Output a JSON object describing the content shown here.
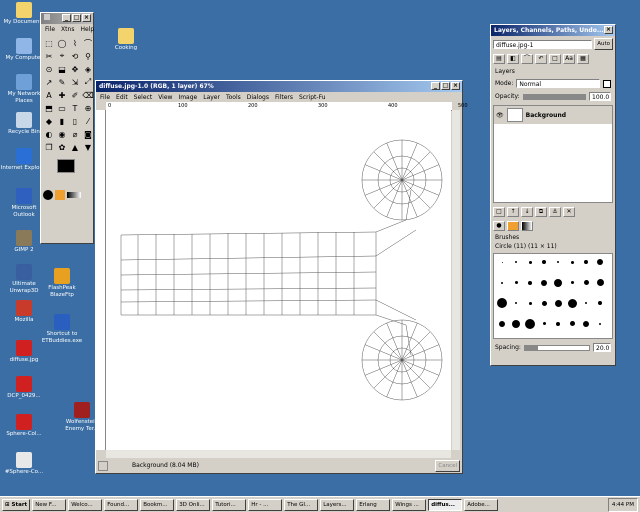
{
  "desktop": {
    "icons": [
      {
        "label": "My Documents",
        "color": "#f3d36b"
      },
      {
        "label": "My Computer",
        "color": "#8fb6e6"
      },
      {
        "label": "My Network Places",
        "color": "#6fa0d8"
      },
      {
        "label": "Recycle Bin",
        "color": "#c8d8e8"
      },
      {
        "label": "Internet Explorer",
        "color": "#2a6fd6"
      },
      {
        "label": "Microsoft Outlook",
        "color": "#2f5fbf"
      },
      {
        "label": "GIMP 2",
        "color": "#8a7a5a"
      },
      {
        "label": "Ultimate Unwrap3D",
        "color": "#3a5fa0"
      },
      {
        "label": "Mozilla",
        "color": "#c83a2a"
      },
      {
        "label": "diffuse.jpg",
        "color": "#d02020"
      },
      {
        "label": "DCP_0429...",
        "color": "#d02020"
      },
      {
        "label": "Sphere-Col...",
        "color": "#d02020"
      },
      {
        "label": "#Sphere-Co...",
        "color": "#e8e8e8"
      }
    ],
    "icons_col2": [
      {
        "label": "FlashPeak BlazeFtp",
        "color": "#e8a020"
      },
      {
        "label": "Shortcut to ETBuddies.exe",
        "color": "#2a5fbf"
      },
      {
        "label": "Wolfenstein Enemy Ter...",
        "color": "#a02020"
      }
    ],
    "cooking": {
      "label": "Cooking",
      "color": "#f3d36b"
    },
    "partial_label": "S"
  },
  "toolbox": {
    "menu": [
      "File",
      "Xtns",
      "Help"
    ],
    "tools": [
      "⬚",
      "◯",
      "⌇",
      "⌒",
      "✂",
      "⌖",
      "⟲",
      "⚲",
      "⊙",
      "⬓",
      "✥",
      "◈",
      "↗",
      "✎",
      "⇲",
      "⤢",
      "A",
      "✚",
      "✐",
      "⌫",
      "⬒",
      "▭",
      "T",
      "⊕",
      "◆",
      "▮",
      "▯",
      "⁄",
      "◐",
      "◉",
      "⌀",
      "◙",
      "❐",
      "✿",
      "▲",
      "▼"
    ],
    "fg_color": "#000000",
    "bg_color": "#ffffff"
  },
  "image_window": {
    "title": "diffuse.jpg-1.0 (RGB, 1 layer) 67%",
    "menu": [
      "File",
      "Edit",
      "Select",
      "View",
      "Image",
      "Layer",
      "Tools",
      "Dialogs",
      "Filters",
      "Script-Fu"
    ],
    "ruler_labels": [
      "0",
      "100",
      "200",
      "300",
      "400",
      "500"
    ],
    "status": "Background (8.04 MB)",
    "cancel_label": "Cancel"
  },
  "layers_dialog": {
    "title": "Layers, Channels, Paths, Undo...",
    "image_select": "diffuse.jpg-1",
    "auto_label": "Auto",
    "section_label": "Layers",
    "mode_label": "Mode:",
    "mode_value": "Normal",
    "opacity_label": "Opacity:",
    "opacity_value": "100.0",
    "opacity": 1.0,
    "layer_name": "Background",
    "brushes_label": "Brushes",
    "brush_name": "Circle (11) (11 × 11)",
    "spacing_label": "Spacing:",
    "spacing_value": "20.0",
    "spacing": 0.2,
    "accent": "#f0a030"
  },
  "taskbar": {
    "start_label": "Start",
    "tasks": [
      "New F...",
      "Welco...",
      "Found...",
      "Bookm...",
      "3D Onli...",
      "Tutori...",
      "Hr - ...",
      "The GI...",
      "Layers...",
      "Erlang",
      "Wings ...",
      "diffus...",
      "Adobe..."
    ],
    "active_index": 11,
    "clock": "4:44 PM"
  }
}
